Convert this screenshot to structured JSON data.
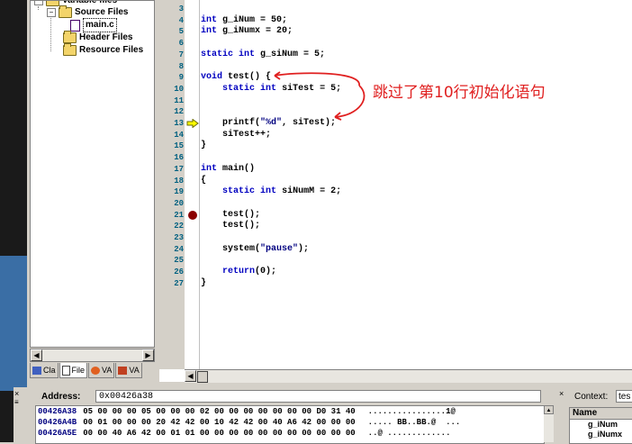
{
  "workspace": {
    "tree": [
      {
        "label": "Variable files",
        "level": 0
      },
      {
        "label": "Source Files",
        "level": 1
      },
      {
        "label": "main.c",
        "level": 2
      },
      {
        "label": "Header Files",
        "level": 1
      },
      {
        "label": "Resource Files",
        "level": 1
      }
    ],
    "tabs": [
      "Cla",
      "File",
      "VA",
      "VA"
    ]
  },
  "editor": {
    "lines": [
      {
        "n": "3",
        "code": ""
      },
      {
        "n": "4",
        "code": "int g_iNum = 50;"
      },
      {
        "n": "5",
        "code": "int g_iNumx = 20;"
      },
      {
        "n": "6",
        "code": ""
      },
      {
        "n": "7",
        "code": "static int g_siNum = 5;"
      },
      {
        "n": "8",
        "code": ""
      },
      {
        "n": "9",
        "code": "void test() {"
      },
      {
        "n": "10",
        "code": "    static int siTest = 5;"
      },
      {
        "n": "11",
        "code": ""
      },
      {
        "n": "12",
        "code": ""
      },
      {
        "n": "13",
        "code": "    printf(\"%d\", siTest);"
      },
      {
        "n": "14",
        "code": "    siTest++;"
      },
      {
        "n": "15",
        "code": "}"
      },
      {
        "n": "16",
        "code": ""
      },
      {
        "n": "17",
        "code": "int main()"
      },
      {
        "n": "18",
        "code": "{"
      },
      {
        "n": "19",
        "code": "    static int siNumM = 2;"
      },
      {
        "n": "20",
        "code": ""
      },
      {
        "n": "21",
        "code": "    test();"
      },
      {
        "n": "22",
        "code": "    test();"
      },
      {
        "n": "23",
        "code": ""
      },
      {
        "n": "24",
        "code": "    system(\"pause\");"
      },
      {
        "n": "25",
        "code": ""
      },
      {
        "n": "26",
        "code": "    return(0);"
      },
      {
        "n": "27",
        "code": "}"
      }
    ],
    "current_line": "13",
    "breakpoint_line": "21",
    "annotation": "跳过了第10行初始化语句"
  },
  "memory": {
    "address_label": "Address:",
    "address_value": "0x00426a38",
    "rows": [
      {
        "addr": "00426A38",
        "bytes": "05 00 00 00 05 00 00 00 02 00 00 00 00 00 00 00 D0 31 40",
        "ascii": "................1@"
      },
      {
        "addr": "00426A4B",
        "bytes": "00 01 00 00 00 20 42 42 00 10 42 42 00 40 A6 42 00 00 00",
        "ascii": "..... BB..BB.@  ..."
      },
      {
        "addr": "00426A5E",
        "bytes": "00 00 40 A6 42 00 01 01 00 00 00 00 00 00 00 00 00 00 00",
        "ascii": "..@ ............."
      }
    ]
  },
  "context": {
    "label": "Context:",
    "value": "tes",
    "header": "Name",
    "rows": [
      "g_iNum",
      "g_iNumx"
    ]
  },
  "colors": {
    "keyword": "#0000c0",
    "annotation": "#e02020",
    "breakpoint": "#8b0000",
    "line_number": "#006080"
  }
}
